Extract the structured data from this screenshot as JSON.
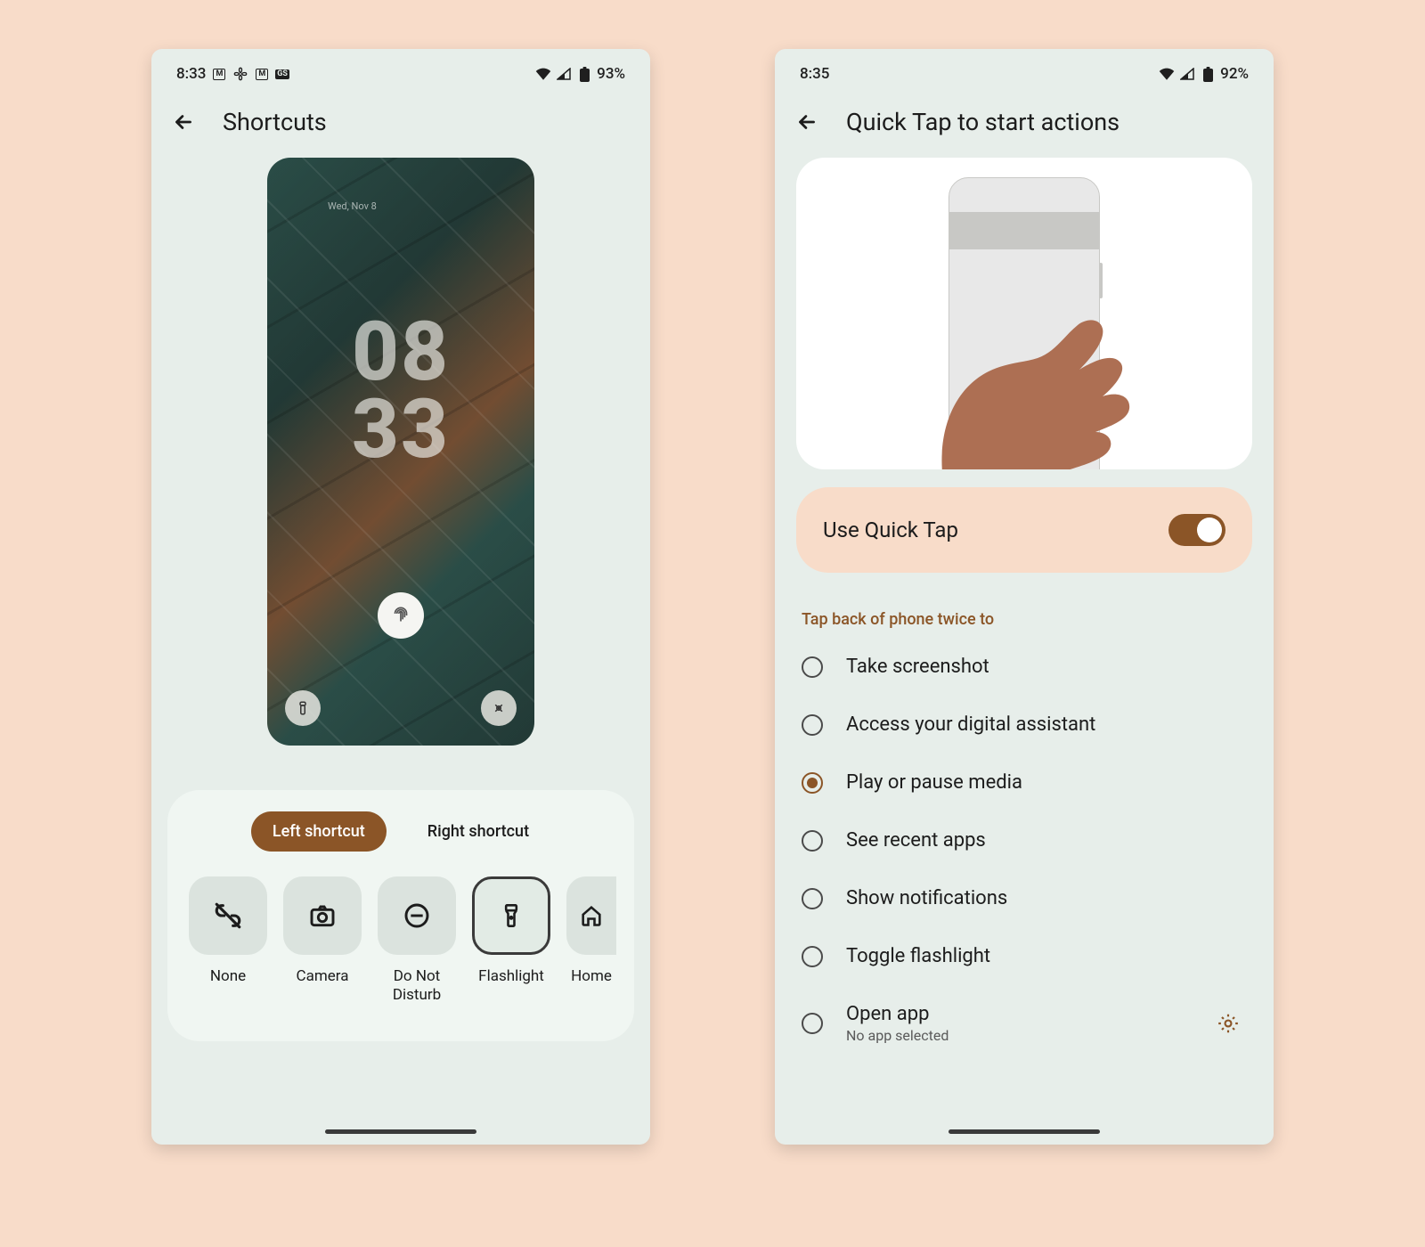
{
  "phone1": {
    "status": {
      "time": "8:33",
      "battery": "93%"
    },
    "title": "Shortcuts",
    "lock": {
      "time_top": "08",
      "time_bottom": "33",
      "weekday": "Wed, Nov 8"
    },
    "tabs": {
      "left": "Left shortcut",
      "right": "Right shortcut",
      "active": "left"
    },
    "shortcuts": [
      {
        "id": "none",
        "label": "None",
        "icon": "link-off"
      },
      {
        "id": "camera",
        "label": "Camera",
        "icon": "camera"
      },
      {
        "id": "dnd",
        "label": "Do Not Disturb",
        "icon": "dnd"
      },
      {
        "id": "flashlight",
        "label": "Flashlight",
        "icon": "flashlight",
        "selected": true
      },
      {
        "id": "home",
        "label": "Home",
        "icon": "home",
        "partial": true
      }
    ]
  },
  "phone2": {
    "status": {
      "time": "8:35",
      "battery": "92%"
    },
    "title": "Quick Tap to start actions",
    "toggle": {
      "label": "Use Quick Tap",
      "on": true
    },
    "section": "Tap back of phone twice to",
    "options": [
      {
        "id": "screenshot",
        "label": "Take screenshot"
      },
      {
        "id": "assistant",
        "label": "Access your digital assistant"
      },
      {
        "id": "media",
        "label": "Play or pause media",
        "selected": true
      },
      {
        "id": "recent",
        "label": "See recent apps"
      },
      {
        "id": "notifications",
        "label": "Show notifications"
      },
      {
        "id": "flashlight",
        "label": "Toggle flashlight"
      },
      {
        "id": "openapp",
        "label": "Open app",
        "sub": "No app selected",
        "gear": true
      }
    ]
  }
}
